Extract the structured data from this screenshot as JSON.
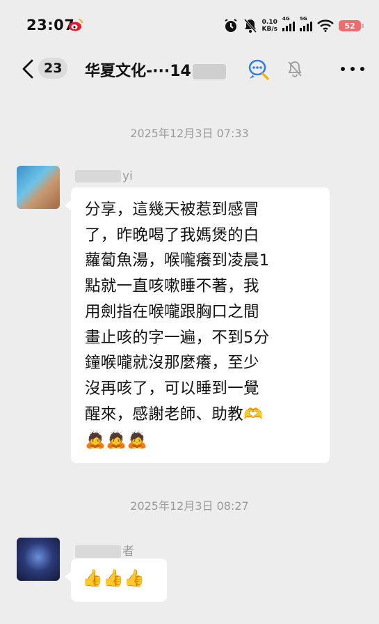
{
  "status_bar": {
    "time": "23:07",
    "net_speed_value": "0.10",
    "net_speed_unit": "KB/s",
    "signal_1_label": "4G",
    "signal_2_label": "5G",
    "battery": "52"
  },
  "header": {
    "unread_count": "23",
    "title": "华夏文化-···14"
  },
  "messages": [
    {
      "timestamp": "2025年12月3日 07:33",
      "sender_suffix": "yi",
      "lines": [
        "分享，這幾天被惹到感冒",
        "了，昨晚喝了我媽煲的白",
        "蘿蔔魚湯，喉嚨癢到凌晨1",
        "點就一直咳嗽睡不著，我",
        "用劍指在喉嚨跟胸口之間",
        "畫止咳的字一遍，不到5分",
        "鐘喉嚨就沒那麼癢，至少",
        "沒再咳了，可以睡到一覺",
        "醒來，感謝老師、助教🫶",
        "🙇🙇🙇"
      ]
    },
    {
      "timestamp": "2025年12月3日 08:27",
      "sender_suffix": "者",
      "lines": [
        "👍👍👍"
      ]
    }
  ],
  "colors": {
    "background": "#ededed",
    "bubble": "#ffffff",
    "timestamp_text": "#9a9a9a",
    "battery": "#f06c6c"
  },
  "icons": [
    "weibo-icon",
    "alarm-icon",
    "mute-status-icon",
    "wifi-icon",
    "back-icon",
    "chat-search-icon",
    "mute-icon",
    "more-icon"
  ]
}
